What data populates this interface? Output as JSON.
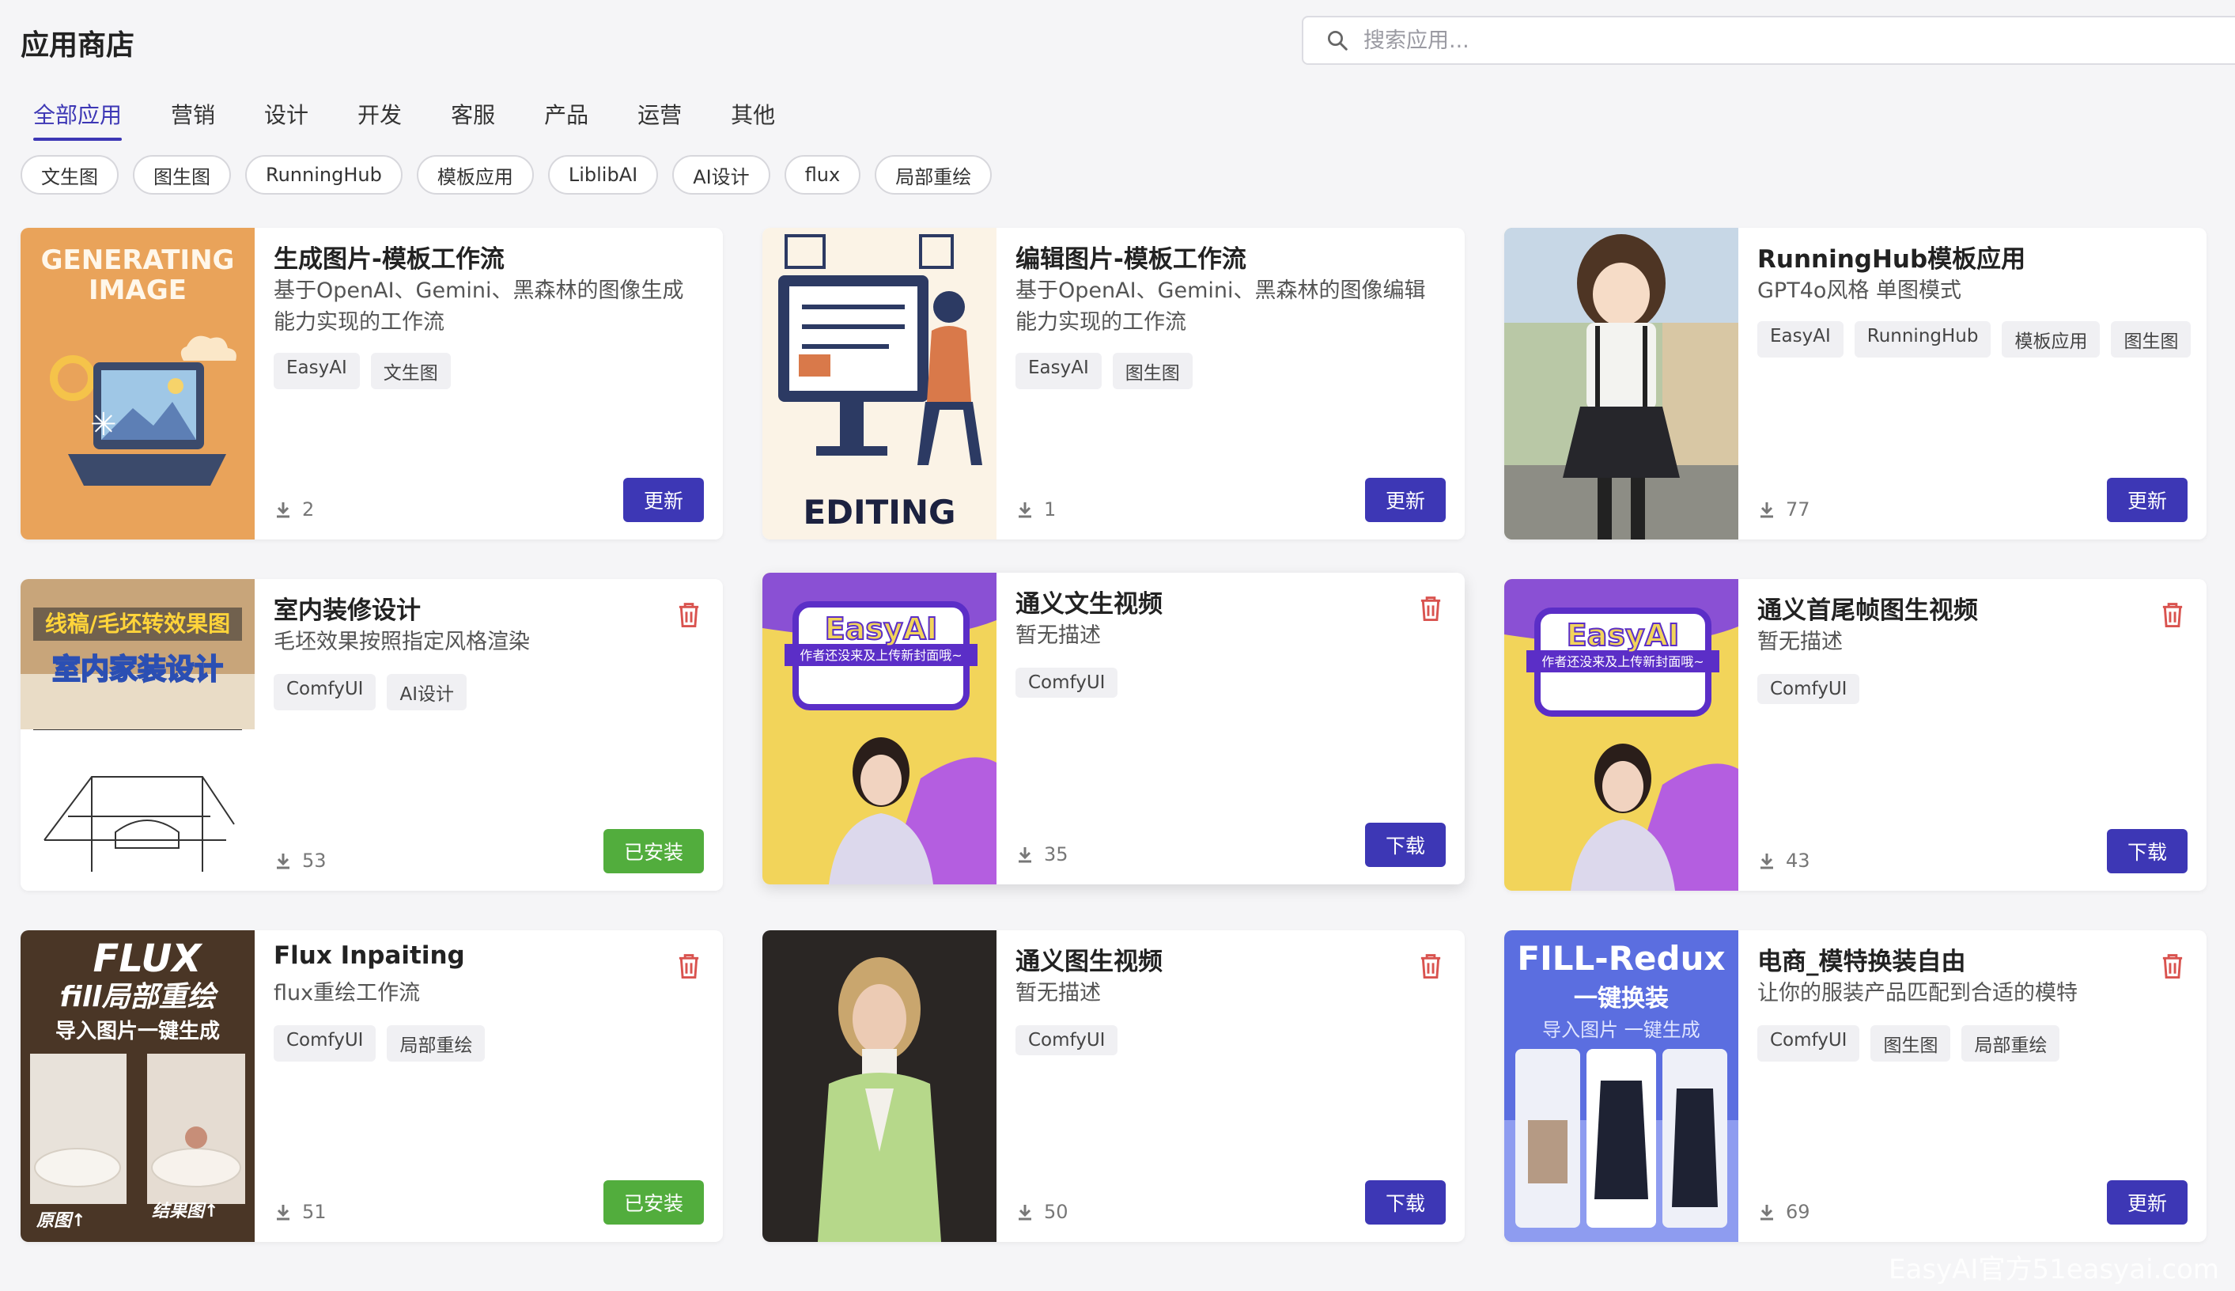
{
  "header": {
    "title": "应用商店",
    "search_placeholder": "搜索应用..."
  },
  "tabs": [
    {
      "label": "全部应用",
      "active": true
    },
    {
      "label": "营销"
    },
    {
      "label": "设计"
    },
    {
      "label": "开发"
    },
    {
      "label": "客服"
    },
    {
      "label": "产品"
    },
    {
      "label": "运营"
    },
    {
      "label": "其他"
    }
  ],
  "chips": [
    "文生图",
    "图生图",
    "RunningHub",
    "模板应用",
    "LiblibAI",
    "AI设计",
    "flux",
    "局部重绘"
  ],
  "cards": [
    {
      "title": "生成图片-模板工作流",
      "desc": "基于OpenAI、Gemini、黑森林的图像生成能力实现的工作流",
      "tags": [
        "EasyAI",
        "文生图"
      ],
      "downloads": "2",
      "button": "更新",
      "thumb_text": [
        "GENERATING",
        "IMAGE"
      ]
    },
    {
      "title": "编辑图片-模板工作流",
      "desc": "基于OpenAI、Gemini、黑森林的图像编辑能力实现的工作流",
      "tags": [
        "EasyAI",
        "图生图"
      ],
      "downloads": "1",
      "button": "更新",
      "thumb_text": [
        "EDITING"
      ]
    },
    {
      "title": "RunningHub模板应用",
      "desc": "GPT4o风格 单图模式",
      "tags": [
        "EasyAI",
        "RunningHub",
        "模板应用",
        "图生图"
      ],
      "downloads": "77",
      "button": "更新"
    },
    {
      "title": "室内装修设计",
      "desc": "毛坯效果按照指定风格渲染",
      "tags": [
        "ComfyUI",
        "AI设计"
      ],
      "downloads": "53",
      "button": "已安装",
      "thumb_text": [
        "线稿/毛坯转效果图",
        "室内家装设计"
      ]
    },
    {
      "title": "通义文生视频",
      "desc": "暂无描述",
      "tags": [
        "ComfyUI"
      ],
      "downloads": "35",
      "button": "下载",
      "thumb_text": [
        "EasyAI",
        "作者还没来及上传新封面哦~"
      ]
    },
    {
      "title": "通义首尾帧图生视频",
      "desc": "暂无描述",
      "tags": [
        "ComfyUI"
      ],
      "downloads": "43",
      "button": "下载",
      "thumb_text": [
        "EasyAI",
        "作者还没来及上传新封面哦~"
      ]
    },
    {
      "title": "Flux Inpaiting",
      "desc": "flux重绘工作流",
      "tags": [
        "ComfyUI",
        "局部重绘"
      ],
      "downloads": "51",
      "button": "已安装",
      "thumb_text": [
        "FLUX",
        "fill局部重绘",
        "导入图片一键生成",
        "原图↑",
        "结果图↑"
      ]
    },
    {
      "title": "通义图生视频",
      "desc": "暂无描述",
      "tags": [
        "ComfyUI"
      ],
      "downloads": "50",
      "button": "下载"
    },
    {
      "title": "电商_模特换装自由",
      "desc": "让你的服装产品匹配到合适的模特",
      "tags": [
        "ComfyUI",
        "图生图",
        "局部重绘"
      ],
      "downloads": "69",
      "button": "更新",
      "thumb_text": [
        "FILL-Redux",
        "一键换装",
        "导入图片  一键生成"
      ]
    }
  ],
  "watermark": "EasyAI官方51easyai.com",
  "colors": {
    "accent": "#3d37b5",
    "installed": "#52ad3d",
    "delete": "#d9534f"
  }
}
